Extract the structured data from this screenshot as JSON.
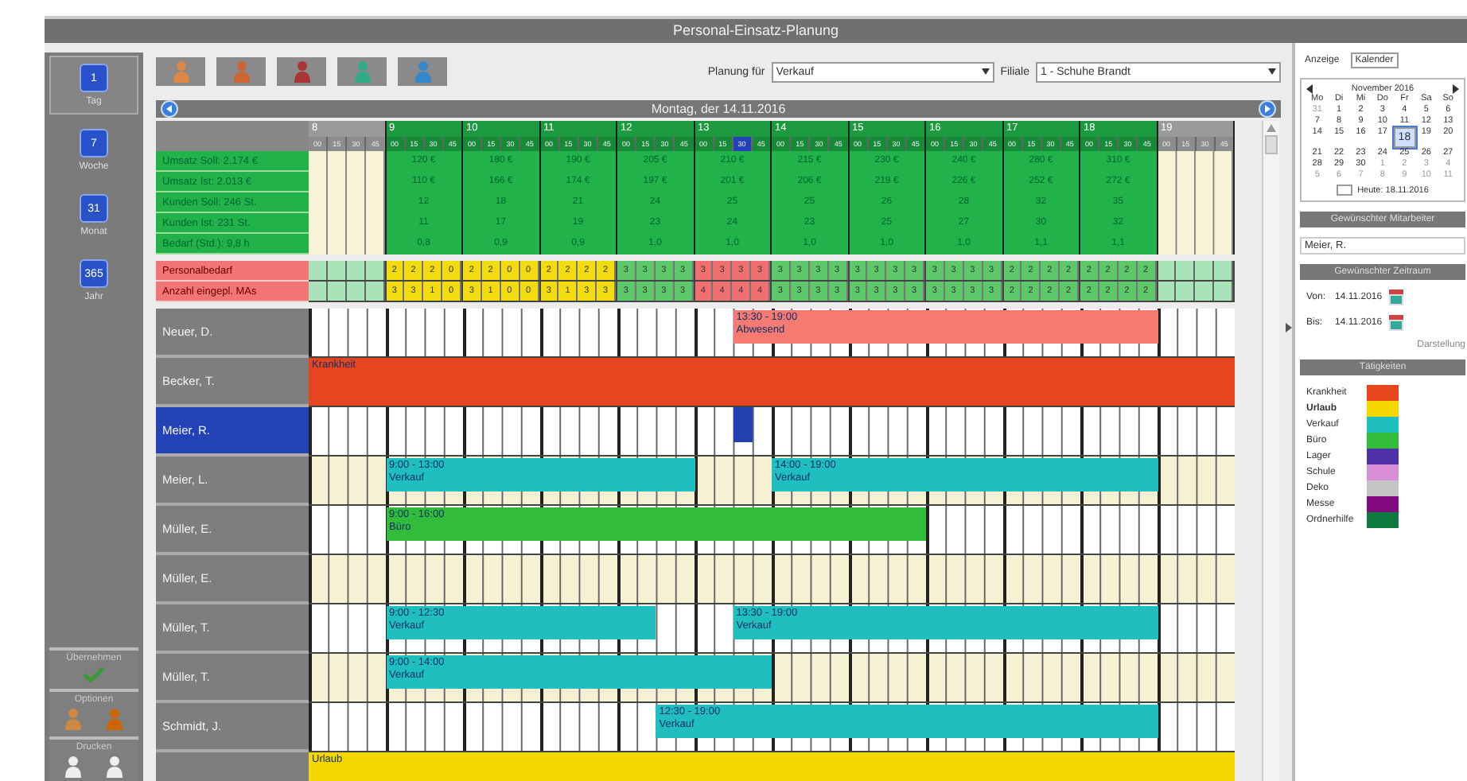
{
  "window": {
    "title": "Personal-Einsatz-Planung"
  },
  "sidebar": {
    "views": [
      {
        "number": "1",
        "label": "Tag",
        "selected": true
      },
      {
        "number": "7",
        "label": "Woche",
        "selected": false
      },
      {
        "number": "31",
        "label": "Monat",
        "selected": false
      },
      {
        "number": "365",
        "label": "Jahr",
        "selected": false
      }
    ],
    "actions": [
      {
        "label": "Übernehmen"
      },
      {
        "label": "Optionen"
      },
      {
        "label": "Drucken"
      }
    ]
  },
  "filters": {
    "planung_label": "Planung für",
    "planung_value": "Verkauf",
    "filiale_label": "Filiale",
    "filiale_value": "1 - Schuhe Brandt"
  },
  "date_bar": {
    "title": "Montag, der 14.11.2016"
  },
  "grid": {
    "hours": [
      {
        "label": "8",
        "open": false,
        "quarters": [
          {
            "label": "00",
            "selected": false
          },
          {
            "label": "15",
            "selected": false
          },
          {
            "label": "30",
            "selected": false
          },
          {
            "label": "45",
            "selected": false
          }
        ]
      },
      {
        "label": "9",
        "open": true,
        "quarters": [
          {
            "label": "00",
            "selected": false
          },
          {
            "label": "15",
            "selected": false
          },
          {
            "label": "30",
            "selected": false
          },
          {
            "label": "45",
            "selected": false
          }
        ]
      },
      {
        "label": "10",
        "open": true,
        "quarters": [
          {
            "label": "00",
            "selected": false
          },
          {
            "label": "15",
            "selected": false
          },
          {
            "label": "30",
            "selected": false
          },
          {
            "label": "45",
            "selected": false
          }
        ]
      },
      {
        "label": "11",
        "open": true,
        "quarters": [
          {
            "label": "00",
            "selected": false
          },
          {
            "label": "15",
            "selected": false
          },
          {
            "label": "30",
            "selected": false
          },
          {
            "label": "45",
            "selected": false
          }
        ]
      },
      {
        "label": "12",
        "open": true,
        "quarters": [
          {
            "label": "00",
            "selected": false
          },
          {
            "label": "15",
            "selected": false
          },
          {
            "label": "30",
            "selected": false
          },
          {
            "label": "45",
            "selected": false
          }
        ]
      },
      {
        "label": "13",
        "open": true,
        "quarters": [
          {
            "label": "00",
            "selected": false
          },
          {
            "label": "15",
            "selected": false
          },
          {
            "label": "30",
            "selected": true
          },
          {
            "label": "45",
            "selected": false
          }
        ]
      },
      {
        "label": "14",
        "open": true,
        "quarters": [
          {
            "label": "00",
            "selected": false
          },
          {
            "label": "15",
            "selected": false
          },
          {
            "label": "30",
            "selected": false
          },
          {
            "label": "45",
            "selected": false
          }
        ]
      },
      {
        "label": "15",
        "open": true,
        "quarters": [
          {
            "label": "00",
            "selected": false
          },
          {
            "label": "15",
            "selected": false
          },
          {
            "label": "30",
            "selected": false
          },
          {
            "label": "45",
            "selected": false
          }
        ]
      },
      {
        "label": "16",
        "open": true,
        "quarters": [
          {
            "label": "00",
            "selected": false
          },
          {
            "label": "15",
            "selected": false
          },
          {
            "label": "30",
            "selected": false
          },
          {
            "label": "45",
            "selected": false
          }
        ]
      },
      {
        "label": "17",
        "open": true,
        "quarters": [
          {
            "label": "00",
            "selected": false
          },
          {
            "label": "15",
            "selected": false
          },
          {
            "label": "30",
            "selected": false
          },
          {
            "label": "45",
            "selected": false
          }
        ]
      },
      {
        "label": "18",
        "open": true,
        "quarters": [
          {
            "label": "00",
            "selected": false
          },
          {
            "label": "15",
            "selected": false
          },
          {
            "label": "30",
            "selected": false
          },
          {
            "label": "45",
            "selected": false
          }
        ]
      },
      {
        "label": "19",
        "open": false,
        "quarters": [
          {
            "label": "00",
            "selected": false
          },
          {
            "label": "15",
            "selected": false
          },
          {
            "label": "30",
            "selected": false
          },
          {
            "label": "45",
            "selected": false
          }
        ]
      }
    ],
    "summary_rows": [
      {
        "label": "Umsatz Soll: 2.174 €",
        "values": [
          "120 €",
          "180 €",
          "190 €",
          "205 €",
          "210 €",
          "215 €",
          "230 €",
          "240 €",
          "280 €",
          "310 €"
        ]
      },
      {
        "label": "Umsatz Ist: 2.013 €",
        "values": [
          "110 €",
          "166 €",
          "174 €",
          "197 €",
          "201 €",
          "206 €",
          "219 €",
          "226 €",
          "252 €",
          "272 €"
        ]
      },
      {
        "label": "Kunden Soll: 246 St.",
        "values": [
          "12",
          "18",
          "21",
          "24",
          "25",
          "25",
          "26",
          "28",
          "32",
          "35"
        ]
      },
      {
        "label": "Kunden Ist: 231 St.",
        "values": [
          "11",
          "17",
          "19",
          "23",
          "24",
          "23",
          "25",
          "27",
          "30",
          "32"
        ]
      },
      {
        "label": "Bedarf (Std.): 9,8 h",
        "values": [
          "0,8",
          "0,9",
          "0,9",
          "1,0",
          "1,0",
          "1,0",
          "1,0",
          "1,0",
          "1,1",
          "1,1"
        ]
      }
    ],
    "staffing_rows": [
      {
        "label": "Personalbedarf",
        "cells": [
          {
            "color": "#f2dc10",
            "values": [
              "2",
              "2",
              "2",
              "0"
            ]
          },
          {
            "color": "#f2dc10",
            "values": [
              "2",
              "2",
              "0",
              "0"
            ]
          },
          {
            "color": "#f2dc10",
            "values": [
              "2",
              "2",
              "2",
              "2"
            ]
          },
          {
            "color": "#5cc86a",
            "values": [
              "3",
              "3",
              "3",
              "3"
            ]
          },
          {
            "color": "#f07070",
            "values": [
              "3",
              "3",
              "3",
              "3"
            ]
          },
          {
            "color": "#5cc86a",
            "values": [
              "3",
              "3",
              "3",
              "3"
            ]
          },
          {
            "color": "#5cc86a",
            "values": [
              "3",
              "3",
              "3",
              "3"
            ]
          },
          {
            "color": "#5cc86a",
            "values": [
              "3",
              "3",
              "3",
              "3"
            ]
          },
          {
            "color": "#5cc86a",
            "values": [
              "2",
              "2",
              "2",
              "2"
            ]
          },
          {
            "color": "#5cc86a",
            "values": [
              "2",
              "2",
              "2",
              "2"
            ]
          }
        ]
      },
      {
        "label": "Anzahl eingepl. MAs",
        "cells": [
          {
            "color": "#f2dc10",
            "values": [
              "3",
              "3",
              "1",
              "0"
            ]
          },
          {
            "color": "#f2dc10",
            "values": [
              "3",
              "1",
              "0",
              "0"
            ]
          },
          {
            "color": "#f2dc10",
            "values": [
              "3",
              "1",
              "3",
              "3"
            ]
          },
          {
            "color": "#5cc86a",
            "values": [
              "3",
              "3",
              "3",
              "3"
            ]
          },
          {
            "color": "#f07070",
            "values": [
              "4",
              "4",
              "4",
              "4"
            ]
          },
          {
            "color": "#5cc86a",
            "values": [
              "3",
              "3",
              "3",
              "3"
            ]
          },
          {
            "color": "#5cc86a",
            "values": [
              "3",
              "3",
              "3",
              "3"
            ]
          },
          {
            "color": "#5cc86a",
            "values": [
              "3",
              "3",
              "3",
              "3"
            ]
          },
          {
            "color": "#5cc86a",
            "values": [
              "2",
              "2",
              "2",
              "2"
            ]
          },
          {
            "color": "#5cc86a",
            "values": [
              "2",
              "2",
              "2",
              "2"
            ]
          }
        ]
      }
    ],
    "employees": [
      {
        "name": "Neuer, D.",
        "selected": false,
        "tinted": false,
        "shifts": [
          {
            "time": "13:30 - 19:00",
            "activity": "Abwesend",
            "color": "#f47a72"
          }
        ]
      },
      {
        "name": "Becker, T.",
        "selected": false,
        "shifts": [
          {
            "kind": "full_day",
            "activity": "Krankheit",
            "color": "#e8451e"
          }
        ]
      },
      {
        "name": "Meier, R.",
        "selected": true,
        "tinted": false
      },
      {
        "name": "Meier, L.",
        "selected": false,
        "tinted": true,
        "shifts": [
          {
            "time": "9:00 - 13:00",
            "activity": "Verkauf",
            "color": "#1fbfbf"
          },
          {
            "time": "14:00 - 19:00",
            "activity": "Verkauf",
            "color": "#1fbfbf"
          }
        ]
      },
      {
        "name": "Müller, E.",
        "selected": false,
        "tinted": false,
        "shifts": [
          {
            "time": "9:00 - 16:00",
            "activity": "Büro",
            "color": "#33bb3a"
          }
        ]
      },
      {
        "name": "Müller, E.",
        "selected": false,
        "tinted": true
      },
      {
        "name": "Müller, T.",
        "selected": false,
        "tinted": false,
        "shifts": [
          {
            "time": "9:00 - 12:30",
            "activity": "Verkauf",
            "color": "#1fbfbf"
          },
          {
            "time": "13:30 - 19:00",
            "activity": "Verkauf",
            "color": "#1fbfbf"
          }
        ]
      },
      {
        "name": "Müller, T.",
        "selected": false,
        "tinted": true,
        "shifts": [
          {
            "time": "9:00 - 14:00",
            "activity": "Verkauf",
            "color": "#1fbfbf"
          }
        ]
      },
      {
        "name": "Schmidt, J.",
        "selected": false,
        "tinted": false,
        "shifts": [
          {
            "time": "12:30 - 19:00",
            "activity": "Verkauf",
            "color": "#1fbfbf"
          }
        ]
      },
      {
        "selected": false,
        "shifts": [
          {
            "kind": "full_day",
            "activity": "Urlaub",
            "color": "#f5d800"
          }
        ]
      }
    ]
  },
  "right_panel": {
    "tabs": [
      {
        "label": "Anzeige",
        "selected": false
      },
      {
        "label": "Kalender",
        "selected": true
      }
    ],
    "calendar": {
      "month": "November 2016",
      "weekdays": [
        "Mo",
        "Di",
        "Mi",
        "Do",
        "Fr",
        "Sa",
        "So"
      ],
      "days": [
        {
          "day": "31",
          "muted": true,
          "selected": false
        },
        {
          "day": "1",
          "muted": false,
          "selected": false
        },
        {
          "day": "2",
          "muted": false,
          "selected": false
        },
        {
          "day": "3",
          "muted": false,
          "selected": false
        },
        {
          "day": "4",
          "muted": false,
          "selected": false
        },
        {
          "day": "5",
          "muted": false,
          "selected": false
        },
        {
          "day": "6",
          "muted": false,
          "selected": false
        },
        {
          "day": "7",
          "muted": false,
          "selected": false
        },
        {
          "day": "8",
          "muted": false,
          "selected": false
        },
        {
          "day": "9",
          "muted": false,
          "selected": false
        },
        {
          "day": "10",
          "muted": false,
          "selected": false
        },
        {
          "day": "11",
          "muted": false,
          "selected": false
        },
        {
          "day": "12",
          "muted": false,
          "selected": false
        },
        {
          "day": "13",
          "muted": false,
          "selected": false
        },
        {
          "day": "14",
          "muted": false,
          "selected": false
        },
        {
          "day": "15",
          "muted": false,
          "selected": false
        },
        {
          "day": "16",
          "muted": false,
          "selected": false
        },
        {
          "day": "17",
          "muted": false,
          "selected": false
        },
        {
          "day": "18",
          "muted": false,
          "selected": true
        },
        {
          "day": "19",
          "muted": false,
          "selected": false
        },
        {
          "day": "20",
          "muted": false,
          "selected": false
        },
        {
          "day": "21",
          "muted": false,
          "selected": false
        },
        {
          "day": "22",
          "muted": false,
          "selected": false
        },
        {
          "day": "23",
          "muted": false,
          "selected": false
        },
        {
          "day": "24",
          "muted": false,
          "selected": false
        },
        {
          "day": "25",
          "muted": false,
          "selected": false
        },
        {
          "day": "26",
          "muted": false,
          "selected": false
        },
        {
          "day": "27",
          "muted": false,
          "selected": false
        },
        {
          "day": "28",
          "muted": false,
          "selected": false
        },
        {
          "day": "29",
          "muted": false,
          "selected": false
        },
        {
          "day": "30",
          "muted": false,
          "selected": false
        },
        {
          "day": "1",
          "muted": true,
          "selected": false
        },
        {
          "day": "2",
          "muted": true,
          "selected": false
        },
        {
          "day": "3",
          "muted": true,
          "selected": false
        },
        {
          "day": "4",
          "muted": true,
          "selected": false
        },
        {
          "day": "5",
          "muted": true,
          "selected": false
        },
        {
          "day": "6",
          "muted": true,
          "selected": false
        },
        {
          "day": "7",
          "muted": true,
          "selected": false
        },
        {
          "day": "8",
          "muted": true,
          "selected": false
        },
        {
          "day": "9",
          "muted": true,
          "selected": false
        },
        {
          "day": "10",
          "muted": true,
          "selected": false
        },
        {
          "day": "11",
          "muted": true,
          "selected": false
        }
      ],
      "today": "Heute: 18.11.2016"
    },
    "employee_section": {
      "title": "Gewünschter Mitarbeiter",
      "value": "Meier, R."
    },
    "period_section": {
      "title": "Gewünschter Zeitraum",
      "from_label": "Von:",
      "from_value": "14.11.2016",
      "to_label": "Bis:",
      "to_value": "14.11.2016",
      "link": "Darstellung"
    },
    "activities_section": {
      "title": "Tätigkeiten",
      "items": [
        {
          "label": "Krankheit",
          "color": "#e8451e",
          "highlighted": false
        },
        {
          "label": "Urlaub",
          "color": "#f5d800",
          "highlighted": true
        },
        {
          "label": "Verkauf",
          "color": "#1fbfbf",
          "highlighted": false
        },
        {
          "label": "Büro",
          "color": "#33bb3a",
          "highlighted": false
        },
        {
          "label": "Lager",
          "color": "#5030a8",
          "highlighted": false
        },
        {
          "label": "Schule",
          "color": "#d88ed4",
          "highlighted": false
        },
        {
          "label": "Deko",
          "color": "#c4c4c4",
          "highlighted": false
        },
        {
          "label": "Messe",
          "color": "#820a80",
          "highlighted": false
        },
        {
          "label": "Ordnerhilfe",
          "color": "#0e7a40",
          "highlighted": false
        }
      ]
    }
  }
}
